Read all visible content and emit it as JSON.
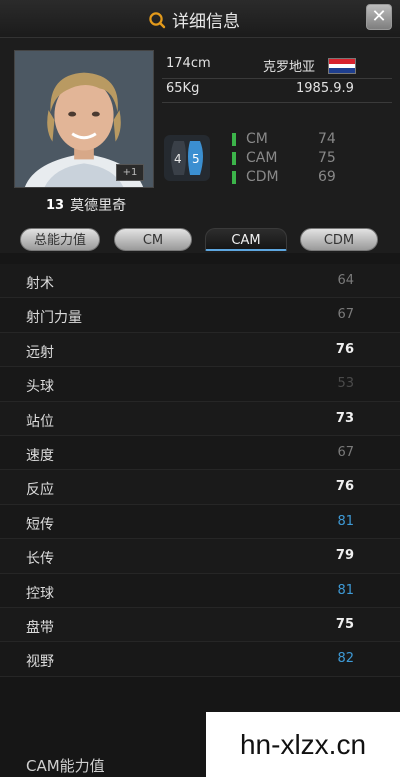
{
  "window": {
    "title": "详细信息",
    "close_icon": "close-icon"
  },
  "player": {
    "height": "174cm",
    "weight": "65Kg",
    "nationality": "克罗地亚",
    "birthdate": "1985.9.9",
    "number": "13",
    "name": "莫德里奇",
    "plus_badge": "+1",
    "foot": {
      "left": "4",
      "right": "5"
    }
  },
  "positions": [
    {
      "name": "CM",
      "value": "74"
    },
    {
      "name": "CAM",
      "value": "75"
    },
    {
      "name": "CDM",
      "value": "69"
    }
  ],
  "tabs": [
    {
      "label": "总能力值",
      "active": false
    },
    {
      "label": "CM",
      "active": false
    },
    {
      "label": "CAM",
      "active": true
    },
    {
      "label": "CDM",
      "active": false
    }
  ],
  "stats": [
    {
      "name": "射术",
      "value": "64",
      "color": "#7a7a7a"
    },
    {
      "name": "射门力量",
      "value": "67",
      "color": "#7a7a7a"
    },
    {
      "name": "远射",
      "value": "76",
      "color": "#f0f0f0"
    },
    {
      "name": "头球",
      "value": "53",
      "color": "#4a4a4a"
    },
    {
      "name": "站位",
      "value": "73",
      "color": "#f0f0f0"
    },
    {
      "name": "速度",
      "value": "67",
      "color": "#7a7a7a"
    },
    {
      "name": "反应",
      "value": "76",
      "color": "#f0f0f0"
    },
    {
      "name": "短传",
      "value": "81",
      "color": "#3e9ad6"
    },
    {
      "name": "长传",
      "value": "79",
      "color": "#f0f0f0"
    },
    {
      "name": "控球",
      "value": "81",
      "color": "#3e9ad6"
    },
    {
      "name": "盘带",
      "value": "75",
      "color": "#f0f0f0"
    },
    {
      "name": "视野",
      "value": "82",
      "color": "#3e9ad6"
    }
  ],
  "footer_label": "CAM能力值",
  "watermark": "hn-xlzx.cn",
  "colors": {
    "accent": "#e39a1b",
    "position_bar": "#3cb44a",
    "high_stat": "#3e9ad6"
  }
}
